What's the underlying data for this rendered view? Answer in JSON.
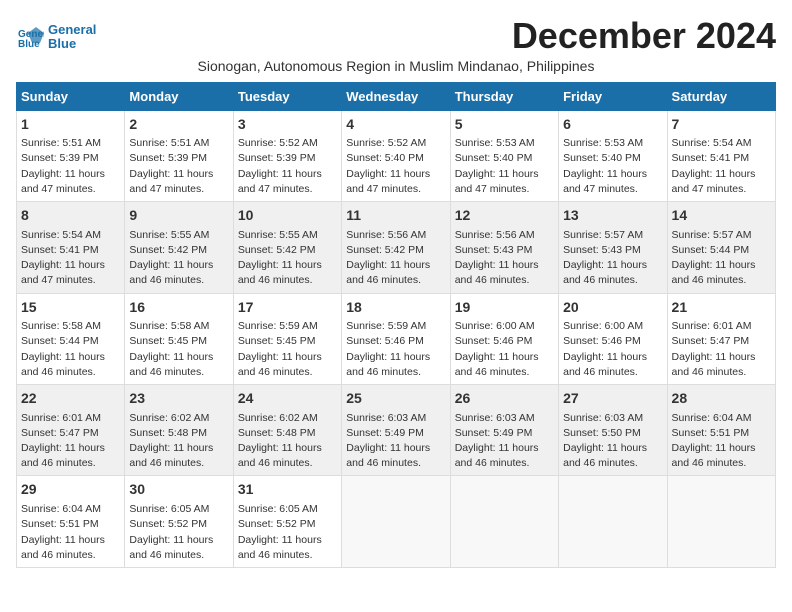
{
  "app": {
    "logo_line1": "General",
    "logo_line2": "Blue"
  },
  "header": {
    "month_title": "December 2024",
    "subtitle": "Sionogan, Autonomous Region in Muslim Mindanao, Philippines"
  },
  "days_of_week": [
    "Sunday",
    "Monday",
    "Tuesday",
    "Wednesday",
    "Thursday",
    "Friday",
    "Saturday"
  ],
  "weeks": [
    [
      {
        "day": "1",
        "rise": "Sunrise: 5:51 AM",
        "set": "Sunset: 5:39 PM",
        "light": "Daylight: 11 hours and 47 minutes."
      },
      {
        "day": "2",
        "rise": "Sunrise: 5:51 AM",
        "set": "Sunset: 5:39 PM",
        "light": "Daylight: 11 hours and 47 minutes."
      },
      {
        "day": "3",
        "rise": "Sunrise: 5:52 AM",
        "set": "Sunset: 5:39 PM",
        "light": "Daylight: 11 hours and 47 minutes."
      },
      {
        "day": "4",
        "rise": "Sunrise: 5:52 AM",
        "set": "Sunset: 5:40 PM",
        "light": "Daylight: 11 hours and 47 minutes."
      },
      {
        "day": "5",
        "rise": "Sunrise: 5:53 AM",
        "set": "Sunset: 5:40 PM",
        "light": "Daylight: 11 hours and 47 minutes."
      },
      {
        "day": "6",
        "rise": "Sunrise: 5:53 AM",
        "set": "Sunset: 5:40 PM",
        "light": "Daylight: 11 hours and 47 minutes."
      },
      {
        "day": "7",
        "rise": "Sunrise: 5:54 AM",
        "set": "Sunset: 5:41 PM",
        "light": "Daylight: 11 hours and 47 minutes."
      }
    ],
    [
      {
        "day": "8",
        "rise": "Sunrise: 5:54 AM",
        "set": "Sunset: 5:41 PM",
        "light": "Daylight: 11 hours and 47 minutes."
      },
      {
        "day": "9",
        "rise": "Sunrise: 5:55 AM",
        "set": "Sunset: 5:42 PM",
        "light": "Daylight: 11 hours and 46 minutes."
      },
      {
        "day": "10",
        "rise": "Sunrise: 5:55 AM",
        "set": "Sunset: 5:42 PM",
        "light": "Daylight: 11 hours and 46 minutes."
      },
      {
        "day": "11",
        "rise": "Sunrise: 5:56 AM",
        "set": "Sunset: 5:42 PM",
        "light": "Daylight: 11 hours and 46 minutes."
      },
      {
        "day": "12",
        "rise": "Sunrise: 5:56 AM",
        "set": "Sunset: 5:43 PM",
        "light": "Daylight: 11 hours and 46 minutes."
      },
      {
        "day": "13",
        "rise": "Sunrise: 5:57 AM",
        "set": "Sunset: 5:43 PM",
        "light": "Daylight: 11 hours and 46 minutes."
      },
      {
        "day": "14",
        "rise": "Sunrise: 5:57 AM",
        "set": "Sunset: 5:44 PM",
        "light": "Daylight: 11 hours and 46 minutes."
      }
    ],
    [
      {
        "day": "15",
        "rise": "Sunrise: 5:58 AM",
        "set": "Sunset: 5:44 PM",
        "light": "Daylight: 11 hours and 46 minutes."
      },
      {
        "day": "16",
        "rise": "Sunrise: 5:58 AM",
        "set": "Sunset: 5:45 PM",
        "light": "Daylight: 11 hours and 46 minutes."
      },
      {
        "day": "17",
        "rise": "Sunrise: 5:59 AM",
        "set": "Sunset: 5:45 PM",
        "light": "Daylight: 11 hours and 46 minutes."
      },
      {
        "day": "18",
        "rise": "Sunrise: 5:59 AM",
        "set": "Sunset: 5:46 PM",
        "light": "Daylight: 11 hours and 46 minutes."
      },
      {
        "day": "19",
        "rise": "Sunrise: 6:00 AM",
        "set": "Sunset: 5:46 PM",
        "light": "Daylight: 11 hours and 46 minutes."
      },
      {
        "day": "20",
        "rise": "Sunrise: 6:00 AM",
        "set": "Sunset: 5:46 PM",
        "light": "Daylight: 11 hours and 46 minutes."
      },
      {
        "day": "21",
        "rise": "Sunrise: 6:01 AM",
        "set": "Sunset: 5:47 PM",
        "light": "Daylight: 11 hours and 46 minutes."
      }
    ],
    [
      {
        "day": "22",
        "rise": "Sunrise: 6:01 AM",
        "set": "Sunset: 5:47 PM",
        "light": "Daylight: 11 hours and 46 minutes."
      },
      {
        "day": "23",
        "rise": "Sunrise: 6:02 AM",
        "set": "Sunset: 5:48 PM",
        "light": "Daylight: 11 hours and 46 minutes."
      },
      {
        "day": "24",
        "rise": "Sunrise: 6:02 AM",
        "set": "Sunset: 5:48 PM",
        "light": "Daylight: 11 hours and 46 minutes."
      },
      {
        "day": "25",
        "rise": "Sunrise: 6:03 AM",
        "set": "Sunset: 5:49 PM",
        "light": "Daylight: 11 hours and 46 minutes."
      },
      {
        "day": "26",
        "rise": "Sunrise: 6:03 AM",
        "set": "Sunset: 5:49 PM",
        "light": "Daylight: 11 hours and 46 minutes."
      },
      {
        "day": "27",
        "rise": "Sunrise: 6:03 AM",
        "set": "Sunset: 5:50 PM",
        "light": "Daylight: 11 hours and 46 minutes."
      },
      {
        "day": "28",
        "rise": "Sunrise: 6:04 AM",
        "set": "Sunset: 5:51 PM",
        "light": "Daylight: 11 hours and 46 minutes."
      }
    ],
    [
      {
        "day": "29",
        "rise": "Sunrise: 6:04 AM",
        "set": "Sunset: 5:51 PM",
        "light": "Daylight: 11 hours and 46 minutes."
      },
      {
        "day": "30",
        "rise": "Sunrise: 6:05 AM",
        "set": "Sunset: 5:52 PM",
        "light": "Daylight: 11 hours and 46 minutes."
      },
      {
        "day": "31",
        "rise": "Sunrise: 6:05 AM",
        "set": "Sunset: 5:52 PM",
        "light": "Daylight: 11 hours and 46 minutes."
      },
      null,
      null,
      null,
      null
    ]
  ]
}
